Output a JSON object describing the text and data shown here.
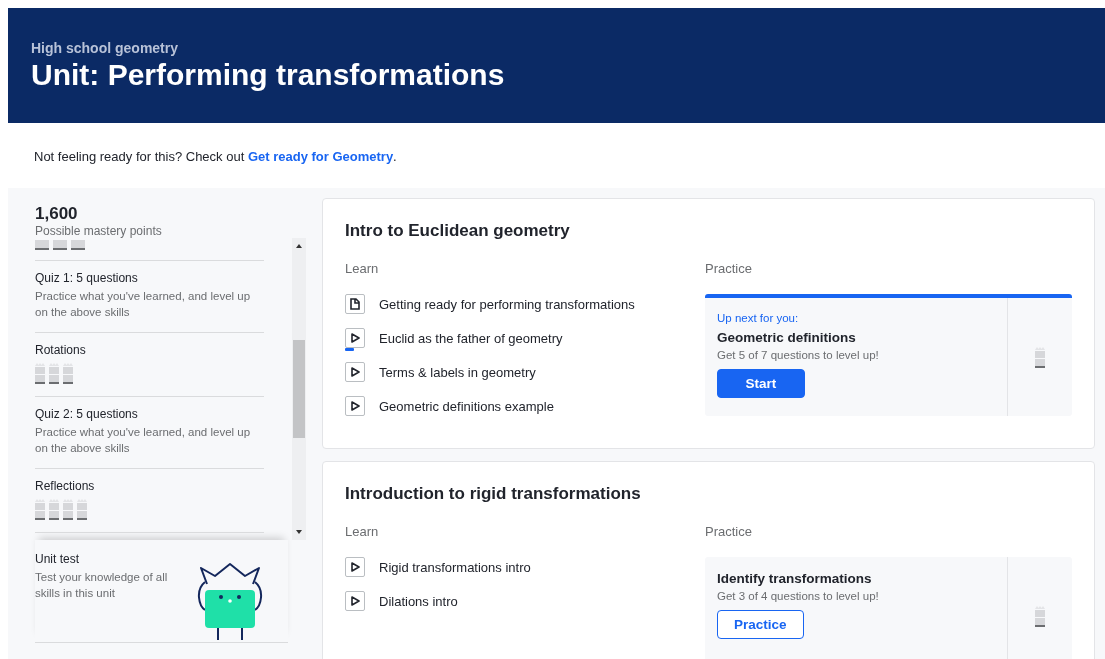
{
  "header": {
    "subject": "High school geometry",
    "title": "Unit: Performing transformations"
  },
  "notice": {
    "text": "Not feeling ready for this? Check out ",
    "link": "Get ready for Geometry",
    "after": "."
  },
  "sidebar": {
    "points": "1,600",
    "points_label": "Possible mastery points",
    "items": [
      {
        "kind": "quiz",
        "title": "Quiz 1: 5 questions",
        "description": "Practice what you've learned, and level up on the above skills"
      },
      {
        "kind": "skill",
        "title": "Rotations",
        "skills": [
          {
            "mastered": false
          },
          {
            "mastered": false
          },
          {
            "mastered": false
          }
        ]
      },
      {
        "kind": "quiz",
        "title": "Quiz 2: 5 questions",
        "description": "Practice what you've learned, and level up on the above skills"
      },
      {
        "kind": "skill",
        "title": "Reflections",
        "skills": [
          {
            "mastered": false
          },
          {
            "mastered": false
          },
          {
            "mastered": false
          },
          {
            "mastered": false
          }
        ]
      }
    ],
    "unit_test": {
      "title": "Unit test",
      "description": "Test your knowledge of all skills in this unit"
    }
  },
  "lessons": [
    {
      "title": "Intro to Euclidean geometry",
      "learn_label": "Learn",
      "practice_label": "Practice",
      "learn": [
        {
          "kind": "article",
          "title": "Getting ready for performing transformations",
          "level": 0
        },
        {
          "kind": "video",
          "title": "Euclid as the father of geometry",
          "level": 0.5
        },
        {
          "kind": "video",
          "title": "Terms & labels in geometry",
          "level": 0
        },
        {
          "kind": "video",
          "title": "Geometric definitions example",
          "level": 0
        }
      ],
      "practice": {
        "up_next": "Up next for you:",
        "title": "Geometric definitions",
        "goal": "Get 5 of 7 questions to level up!",
        "button": {
          "label": "Start",
          "kind": "primary"
        }
      }
    },
    {
      "title": "Introduction to rigid transformations",
      "learn_label": "Learn",
      "practice_label": "Practice",
      "learn": [
        {
          "kind": "video",
          "title": "Rigid transformations intro",
          "level": 0
        },
        {
          "kind": "video",
          "title": "Dilations intro",
          "level": 0
        }
      ],
      "practice": {
        "title": "Identify transformations",
        "goal": "Get 3 of 4 questions to level up!",
        "button": {
          "label": "Practice",
          "kind": "secondary"
        }
      }
    }
  ]
}
